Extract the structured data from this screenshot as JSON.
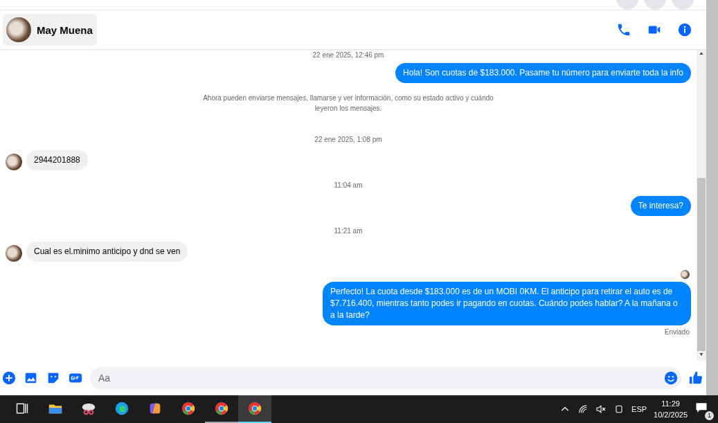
{
  "chat": {
    "contact_name": "May Muena"
  },
  "messages": [
    {
      "kind": "time",
      "text": "22 ene 2025, 12:46 pm"
    },
    {
      "kind": "out",
      "text": "Hola! Son cuotas de $183.000. Pasame tu número para enviarte toda la info"
    },
    {
      "kind": "notice",
      "text": "Ahora pueden enviarse mensajes, llamarse y ver información, como su estado activo y cuándo leyeron los mensajes."
    },
    {
      "kind": "time",
      "text": "22 ene 2025, 1:08 pm"
    },
    {
      "kind": "in",
      "text": "2944201888"
    },
    {
      "kind": "time",
      "text": "11:04 am"
    },
    {
      "kind": "out",
      "text": "Te interesa?"
    },
    {
      "kind": "time",
      "text": "11:21 am"
    },
    {
      "kind": "in",
      "text": "Cual es el.minimo anticipo y dnd se ven"
    },
    {
      "kind": "seen"
    },
    {
      "kind": "out",
      "text": "Perfecto! La cuota desde $183.000 es de un MOBI 0KM. El anticipo para retirar el auto es de $7.716.400, mientras tanto podes ir pagando en cuotas. Cuándo podes hablar? A la mañana o a la tarde?"
    },
    {
      "kind": "status",
      "text": "Enviado"
    }
  ],
  "composer": {
    "placeholder": "Aa"
  },
  "taskbar": {
    "apps": [
      {
        "kind": "taskview",
        "selected": false
      },
      {
        "kind": "folder",
        "selected": false
      },
      {
        "kind": "snip",
        "selected": false
      },
      {
        "kind": "edge",
        "selected": false
      },
      {
        "kind": "copilot",
        "selected": false
      },
      {
        "kind": "chrome",
        "selected": false
      },
      {
        "kind": "chrome",
        "selected": false,
        "running": true
      },
      {
        "kind": "chrome",
        "selected": true,
        "running": true
      }
    ],
    "language": "ESP",
    "time": "11:29",
    "date": "10/2/2025",
    "notifications": "1"
  }
}
